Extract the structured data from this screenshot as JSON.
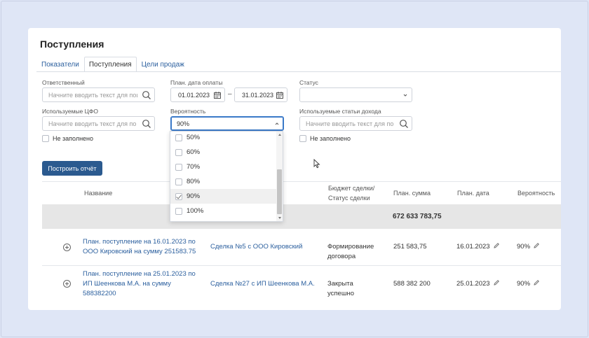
{
  "page": {
    "title": "Поступления"
  },
  "tabs": [
    {
      "label": "Показатели"
    },
    {
      "label": "Поступления"
    },
    {
      "label": "Цели продаж"
    }
  ],
  "filters": {
    "responsible": {
      "label": "Ответственный",
      "placeholder": "Начните вводить текст для поиск"
    },
    "plan_date": {
      "label": "План. дата оплаты",
      "from": "01.01.2023",
      "to": "31.01.2023",
      "dash": "–"
    },
    "status": {
      "label": "Статус",
      "value": ""
    },
    "cfo": {
      "label": "Используемые ЦФО",
      "placeholder": "Начните вводить текст для по"
    },
    "probability": {
      "label": "Вероятность",
      "value": "90%"
    },
    "income_items": {
      "label": "Используемые статьи дохода",
      "placeholder": "Начните вводить текст для по"
    },
    "not_filled_1": "Не заполнено",
    "not_filled_2": "Не заполнено"
  },
  "build_button": "Построить отчёт",
  "probability_options": [
    {
      "label": "50%",
      "checked": false
    },
    {
      "label": "60%",
      "checked": false
    },
    {
      "label": "70%",
      "checked": false
    },
    {
      "label": "80%",
      "checked": false
    },
    {
      "label": "90%",
      "checked": true
    },
    {
      "label": "100%",
      "checked": false
    }
  ],
  "table": {
    "headers": {
      "name": "Название",
      "budget_line1": "Бюджет сделки/",
      "budget_line2": "Статус сделки",
      "plan_sum": "План. сумма",
      "plan_date": "План. дата",
      "probability": "Вероятность"
    },
    "total": "672 633 783,75",
    "rows": [
      {
        "name_line1": "План. поступление на 16.01.2023 по",
        "name_line2": "ООО Кировский на сумму 251583.75",
        "name_line3": "",
        "deal": "Сделка №5 с ООО Кировский",
        "status_line1": "Формирование",
        "status_line2": "договора",
        "sum": "251 583,75",
        "date": "16.01.2023",
        "prob": "90%"
      },
      {
        "name_line1": "План. поступление на 25.01.2023 по",
        "name_line2": "ИП Шеенкова М.А. на сумму",
        "name_line3": "588382200",
        "deal": "Сделка №27 с ИП Шеенкова М.А.",
        "status_line1": "Закрыта",
        "status_line2": "успешно",
        "sum": "588 382 200",
        "date": "25.01.2023",
        "prob": "90%"
      }
    ]
  }
}
